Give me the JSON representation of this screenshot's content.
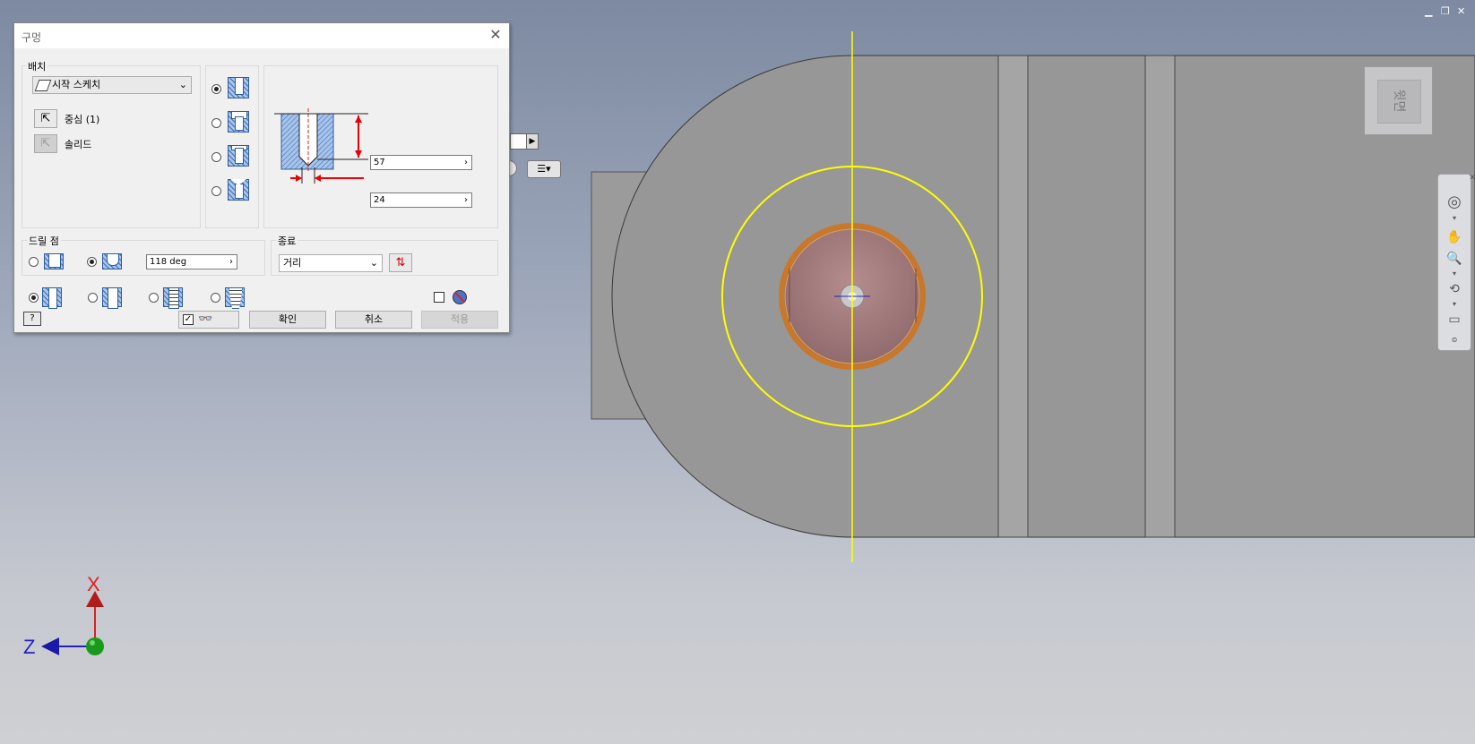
{
  "window": {
    "minimize_icon": "minimize-icon",
    "restore_icon": "restore-icon",
    "close_icon": "close-icon"
  },
  "dialog": {
    "title": "구멍",
    "placement": {
      "group_label": "배치",
      "source_option": "시작 스케치",
      "center_label": "중심 (1)",
      "solid_label": "솔리드"
    },
    "hole_dims": {
      "depth": "57",
      "diameter": "24"
    },
    "drill_point": {
      "group_label": "드릴 점",
      "angle": "118 deg",
      "selected": "angled"
    },
    "termination": {
      "group_label": "종료",
      "option": "거리"
    },
    "buttons": {
      "ok": "확인",
      "cancel": "취소",
      "apply": "적용"
    }
  },
  "viewcube": {
    "face_label": "윗면"
  },
  "triad": {
    "x_label": "X",
    "z_label": "Z"
  },
  "colors": {
    "sketch_yellow": "#ffff00",
    "hole_bronze": "#c8782a",
    "axis_red": "#e02020",
    "axis_blue": "#2020c0",
    "axis_green": "#1a9a1a"
  }
}
